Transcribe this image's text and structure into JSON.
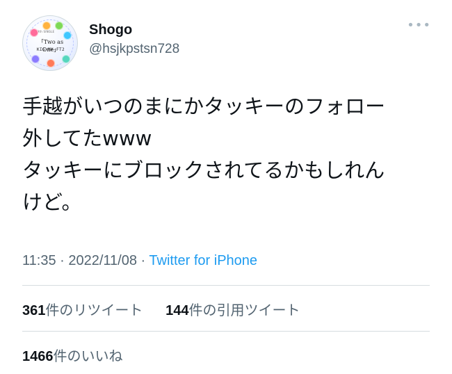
{
  "user": {
    "display_name": "Shogo",
    "handle": "@hsjkpstsn728",
    "avatar": {
      "tiny_text": "29th SINGLE",
      "title": "「Two as One」",
      "brand": "KIS-MY-FT2",
      "colors": [
        "#ff6b9a",
        "#ffb23f",
        "#7ed957",
        "#3fc7ff",
        "#8b7bff",
        "#ff7a59",
        "#55d6be"
      ]
    }
  },
  "tweet": {
    "text": "手越がいつのまにかタッキーのフォロー\n外してたwww\nタッキーにブロックされてるかもしれん\nけど。"
  },
  "meta": {
    "time": "11:35",
    "separator1": " · ",
    "date": "2022/11/08",
    "separator2": " · ",
    "source": "Twitter for iPhone"
  },
  "stats": {
    "retweets": {
      "count": "361",
      "label": "件のリツイート"
    },
    "quotes": {
      "count": "144",
      "label": "件の引用ツイート"
    },
    "likes": {
      "count": "1466",
      "label": "件のいいね"
    }
  },
  "icons": {
    "more": "more-horizontal-icon"
  },
  "colors": {
    "text": "#0f1419",
    "secondary": "#536471",
    "link": "#1d9bf0",
    "divider": "#d6dce0"
  }
}
